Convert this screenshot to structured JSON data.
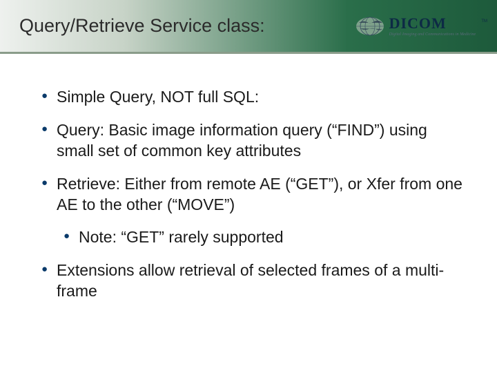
{
  "header": {
    "title": "Query/Retrieve Service class:"
  },
  "brand": {
    "name": "DICOM",
    "tagline": "Digital Imaging and Communications in Medicine",
    "tm": "TM"
  },
  "bullets": [
    {
      "level": 1,
      "text": "Simple Query, NOT full SQL:"
    },
    {
      "level": 1,
      "text": "Query: Basic image information query (“FIND”) using small set of common key attributes"
    },
    {
      "level": 1,
      "text": "Retrieve: Either from remote AE (“GET”), or Xfer from one AE to the other (“MOVE”)"
    },
    {
      "level": 2,
      "text": "Note: “GET” rarely supported"
    },
    {
      "level": 1,
      "text": "Extensions allow retrieval of selected frames of a multi-frame"
    }
  ]
}
